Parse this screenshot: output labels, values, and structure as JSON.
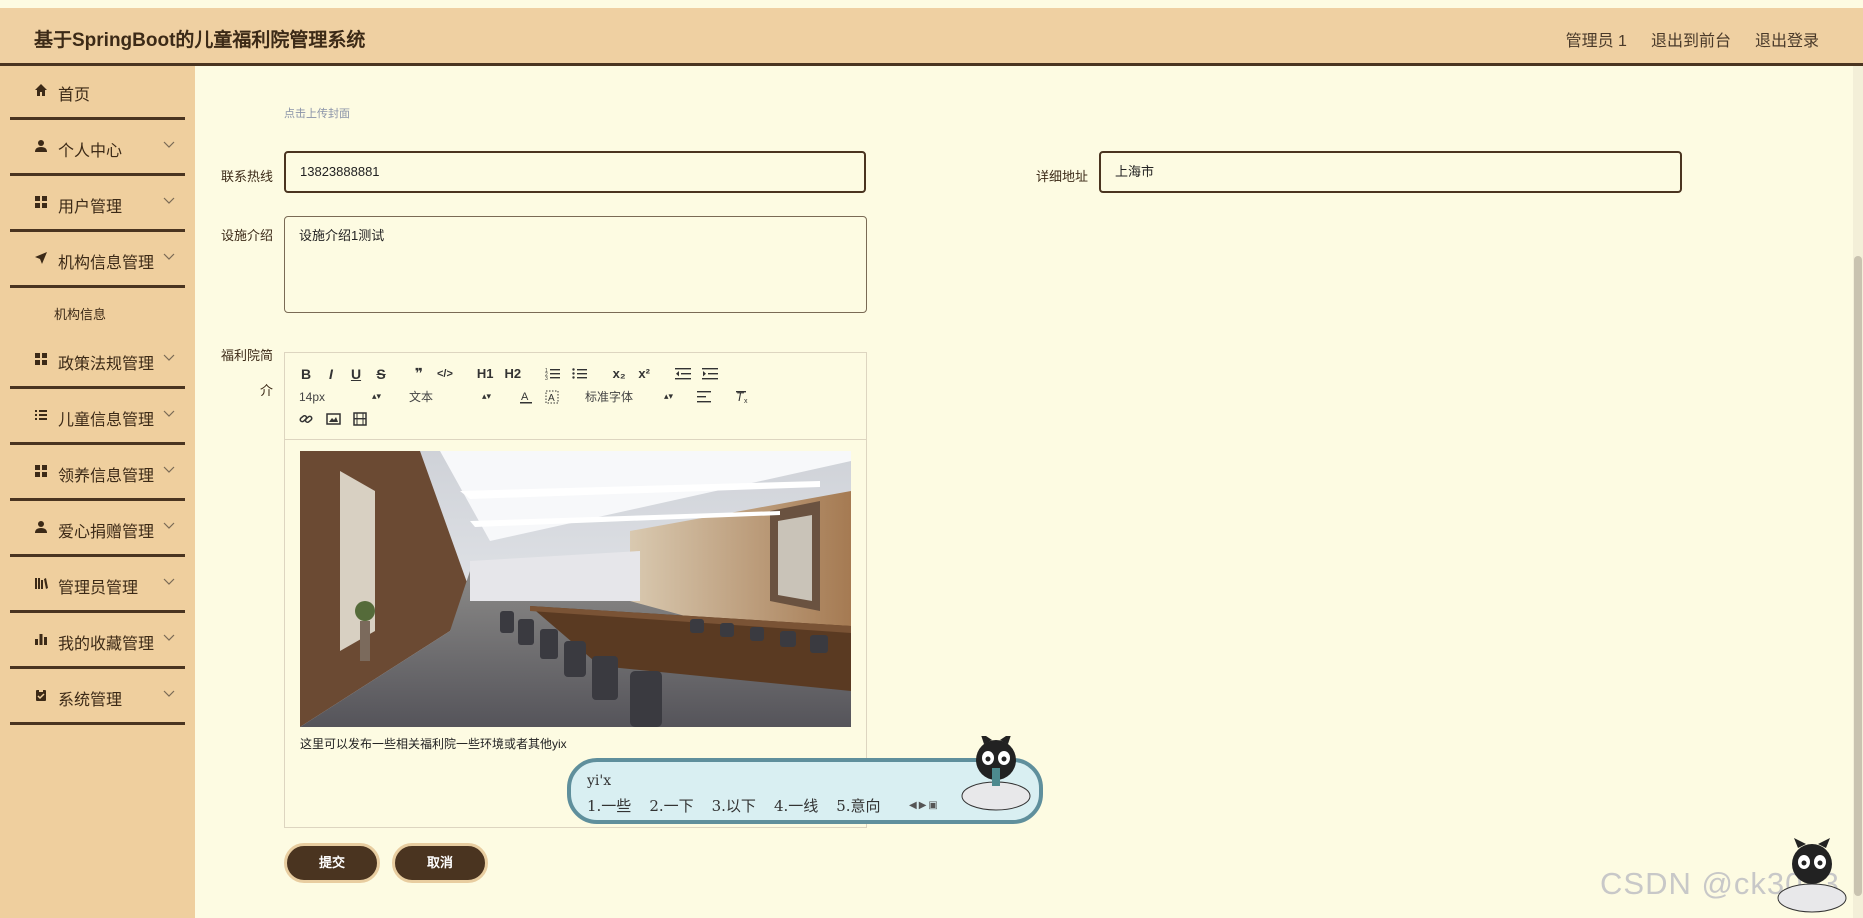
{
  "header": {
    "title": "基于SpringBoot的儿童福利院管理系统",
    "links": [
      "管理员 1",
      "退出到前台",
      "退出登录"
    ]
  },
  "sidebar": {
    "items": [
      {
        "label": "首页",
        "icon": "home-icon",
        "chevron": false
      },
      {
        "label": "个人中心",
        "icon": "user-icon",
        "chevron": true
      },
      {
        "label": "用户管理",
        "icon": "grid-icon",
        "chevron": true
      },
      {
        "label": "机构信息管理",
        "icon": "send-icon",
        "chevron": true
      },
      {
        "label": "政策法规管理",
        "icon": "grid-icon",
        "chevron": true
      },
      {
        "label": "儿童信息管理",
        "icon": "list-icon",
        "chevron": true
      },
      {
        "label": "领养信息管理",
        "icon": "grid-icon",
        "chevron": true
      },
      {
        "label": "爱心捐赠管理",
        "icon": "user-icon",
        "chevron": true
      },
      {
        "label": "管理员管理",
        "icon": "library-icon",
        "chevron": true
      },
      {
        "label": "我的收藏管理",
        "icon": "bar-chart-icon",
        "chevron": true
      },
      {
        "label": "系统管理",
        "icon": "clipboard-icon",
        "chevron": true
      }
    ],
    "subitem": "机构信息"
  },
  "form": {
    "upload_hint": "点击上传封面",
    "phone_label": "联系热线",
    "phone_value": "13823888881",
    "address_label": "详细地址",
    "address_value": "上海市",
    "facility_label": "设施介绍",
    "facility_value": "设施介绍1测试",
    "intro_label_1": "福利院简",
    "intro_label_2": "介",
    "submit_label": "提交",
    "cancel_label": "取消"
  },
  "editor": {
    "toolbar_row1": [
      "B",
      "I",
      "U",
      "S",
      "❞",
      "</>",
      "H1",
      "H2",
      "ol",
      "ul",
      "x₂",
      "x²",
      "outdent",
      "indent"
    ],
    "font_size": "14px",
    "paragraph": "文本",
    "font_family": "标准字体",
    "content_text": "这里可以发布一些相关福利院一些环境或者其他yix"
  },
  "ime": {
    "input": "yi'x",
    "candidates": [
      "1.一些",
      "2.一下",
      "3.以下",
      "4.一线",
      "5.意向"
    ]
  },
  "watermark": "CSDN @ck3013",
  "colors": {
    "header_bg": "#efd0a2",
    "sidebar_bg": "#efcf9e",
    "dark_brown": "#4a3420",
    "page_bg": "#fdfbe2"
  }
}
